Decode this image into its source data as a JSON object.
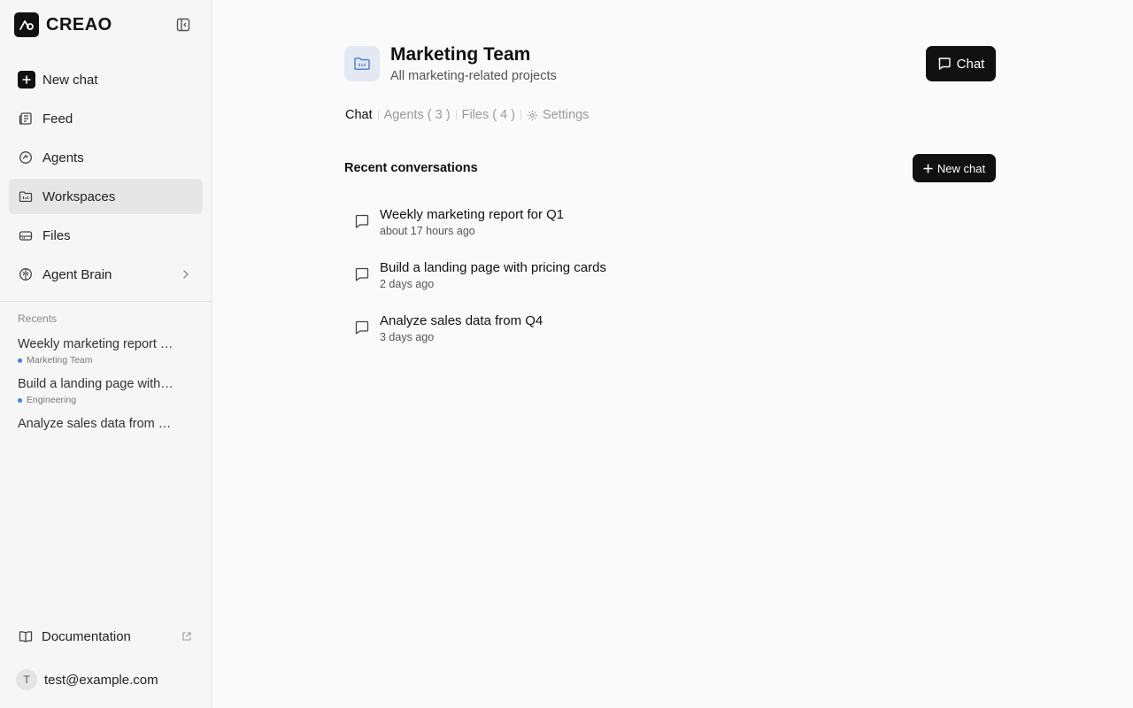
{
  "app": {
    "brand": "CREAO"
  },
  "sidebar": {
    "nav": [
      {
        "label": "New chat",
        "icon": "plus-icon"
      },
      {
        "label": "Feed",
        "icon": "newspaper-icon"
      },
      {
        "label": "Agents",
        "icon": "agent-icon"
      },
      {
        "label": "Workspaces",
        "icon": "folder-icon",
        "active": true
      },
      {
        "label": "Files",
        "icon": "drive-icon"
      },
      {
        "label": "Agent Brain",
        "icon": "brain-icon"
      }
    ],
    "recents_label": "Recents",
    "recents": [
      {
        "title": "Weekly marketing report for Q1",
        "workspace": "Marketing Team"
      },
      {
        "title": "Build a landing page with pricing cards",
        "workspace": "Engineering"
      },
      {
        "title": "Analyze sales data from Q4",
        "workspace": ""
      }
    ],
    "documentation": "Documentation",
    "user": {
      "initial": "T",
      "email": "test@example.com"
    }
  },
  "workspace": {
    "title": "Marketing Team",
    "subtitle": "All marketing-related projects",
    "chat_button": "Chat",
    "tabs": [
      {
        "label": "Chat",
        "active": true
      },
      {
        "label": "Agents ( 3 )"
      },
      {
        "label": "Files ( 4 )"
      },
      {
        "label": "Settings"
      }
    ],
    "section_title": "Recent conversations",
    "new_chat_button": "New chat",
    "conversations": [
      {
        "title": "Weekly marketing report for Q1",
        "time": "about 17 hours ago"
      },
      {
        "title": "Build a landing page with pricing cards",
        "time": "2 days ago"
      },
      {
        "title": "Analyze sales data from Q4",
        "time": "3 days ago"
      }
    ]
  },
  "colors": {
    "accent": "#111111",
    "workspace_dot": "#3b82f6",
    "active_nav_bg": "#e6e6e6"
  }
}
